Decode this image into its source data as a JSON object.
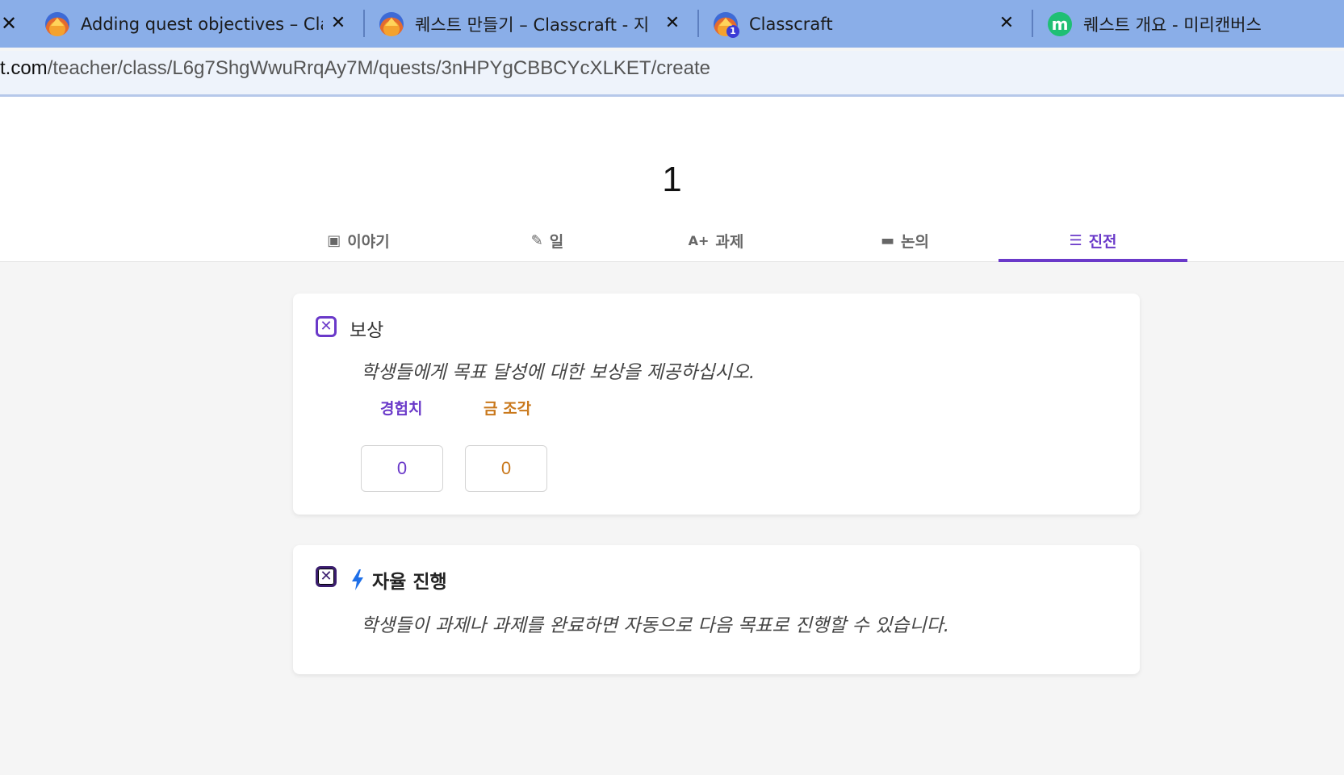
{
  "browser": {
    "tabs": [
      {
        "title": "Adding quest objectives – Class",
        "icon": "classcraft-icon"
      },
      {
        "title": "퀘스트 만들기 – Classcraft - 지",
        "icon": "classcraft-icon"
      },
      {
        "title": "Classcraft",
        "icon": "classcraft-notification-icon",
        "badge": "1"
      },
      {
        "title": "퀘스트 개요 - 미리캔버스",
        "icon": "miricanvas-icon",
        "letter": "m"
      }
    ],
    "close_glyph": "✕",
    "url_host": "t.com",
    "url_path": "/teacher/class/L6g7ShgWwuRrqAy7M/quests/3nHPYgCBBCYcXLKET/create"
  },
  "header": {
    "quest_number": "1",
    "tabs": [
      {
        "label": "이야기",
        "icon": "book-icon",
        "glyph": "▣"
      },
      {
        "label": "일",
        "icon": "edit-icon",
        "glyph": "✎"
      },
      {
        "label": "과제",
        "icon": "grade-icon",
        "glyph": "A+"
      },
      {
        "label": "논의",
        "icon": "chat-icon",
        "glyph": "▬"
      },
      {
        "label": "진전",
        "icon": "checklist-icon",
        "glyph": "☰"
      }
    ],
    "active_tab": "진전"
  },
  "reward_card": {
    "title": "보상",
    "description": "학생들에게 목표 달성에 대한 보상을 제공하십시오.",
    "xp_label": "경험치",
    "gold_label": "금 조각",
    "xp_value": "0",
    "gold_value": "0",
    "check_glyph": "✕"
  },
  "auto_card": {
    "title": "자율 진행",
    "description": "학생들이 과제나 과제를 완료하면 자동으로 다음 목표로 진행할 수 있습니다.",
    "check_glyph": "✕"
  },
  "colors": {
    "accent": "#6a39c9",
    "gold": "#c9781c",
    "tabbar": "#8aaee8"
  }
}
